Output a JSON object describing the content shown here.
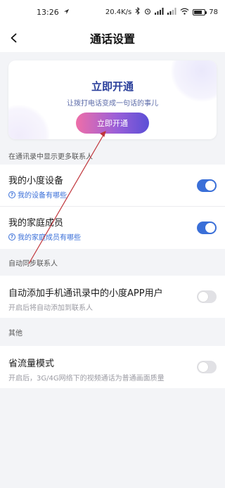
{
  "status_bar": {
    "time": "13:26",
    "speed": "20.4K/s",
    "battery": "78",
    "battery_fraction": 0.78
  },
  "header": {
    "title": "通话设置"
  },
  "banner": {
    "title": "立即开通",
    "subtitle": "让拨打电话变成一句话的事儿",
    "button": "立即开通"
  },
  "sections": [
    {
      "header": "在通讯录中显示更多联系人",
      "rows": [
        {
          "title": "我的小度设备",
          "sub": "我的设备有哪些",
          "sub_type": "link",
          "toggle_on": true
        },
        {
          "title": "我的家庭成员",
          "sub": "我的家庭成员有哪些",
          "sub_type": "link",
          "toggle_on": true
        }
      ]
    },
    {
      "header": "自动同步联系人",
      "rows": [
        {
          "title": "自动添加手机通讯录中的小度APP用户",
          "sub": "开启后将自动添加到联系人",
          "sub_type": "grey",
          "toggle_on": false
        }
      ]
    },
    {
      "header": "其他",
      "rows": [
        {
          "title": "省流量模式",
          "sub": "开启后，3G/4G网络下的视频通话为普通画面质量",
          "sub_type": "grey",
          "toggle_on": false
        }
      ]
    }
  ],
  "colors": {
    "accent": "#3a6fd8",
    "arrow": "#c0343a"
  }
}
